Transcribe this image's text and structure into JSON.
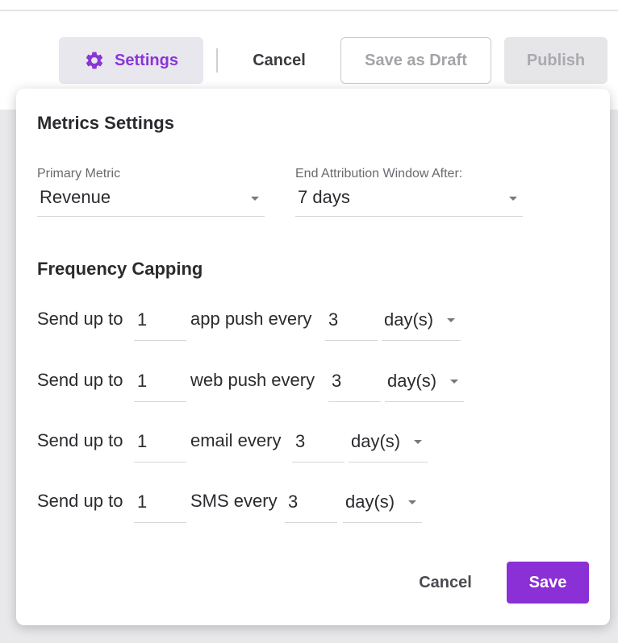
{
  "toolbar": {
    "settings_label": "Settings",
    "cancel_label": "Cancel",
    "save_draft_label": "Save as Draft",
    "publish_label": "Publish"
  },
  "metrics": {
    "title": "Metrics Settings",
    "primary_metric_label": "Primary Metric",
    "primary_metric_value": "Revenue",
    "attribution_label": "End Attribution Window After:",
    "attribution_value": "7 days"
  },
  "frequency": {
    "title": "Frequency Capping",
    "rows": [
      {
        "prefix": "Send up to",
        "count": "1",
        "channel_text": "app push every",
        "interval": "3",
        "unit": "day(s)"
      },
      {
        "prefix": "Send up to",
        "count": "1",
        "channel_text": "web push every",
        "interval": "3",
        "unit": "day(s)"
      },
      {
        "prefix": "Send up to",
        "count": "1",
        "channel_text": "email every",
        "interval": "3",
        "unit": "day(s)"
      },
      {
        "prefix": "Send up to",
        "count": "1",
        "channel_text": "SMS every",
        "interval": "3",
        "unit": "day(s)"
      }
    ]
  },
  "footer": {
    "cancel_label": "Cancel",
    "save_label": "Save"
  },
  "colors": {
    "accent": "#8b2fd6",
    "settings_text": "#8a35d8"
  }
}
